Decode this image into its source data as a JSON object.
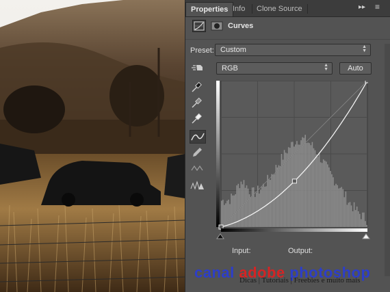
{
  "tabs": [
    {
      "label": "Properties",
      "active": true
    },
    {
      "label": "Info",
      "active": false
    },
    {
      "label": "Clone Source",
      "active": false
    }
  ],
  "tab_controls": {
    "expand": "▸▸",
    "menu": "≡"
  },
  "header": {
    "title": "Curves",
    "icons": [
      "curves-adjustment-icon",
      "layer-mask-icon"
    ]
  },
  "preset": {
    "label": "Preset:",
    "value": "Custom"
  },
  "channel": {
    "value": "RGB"
  },
  "auto_label": "Auto",
  "tools": [
    {
      "name": "target-adjust-hand-icon",
      "active": false
    },
    {
      "name": "black-point-eyedropper-icon",
      "active": false
    },
    {
      "name": "gray-point-eyedropper-icon",
      "active": false
    },
    {
      "name": "white-point-eyedropper-icon",
      "active": false
    },
    {
      "name": "curve-points-icon",
      "active": true
    },
    {
      "name": "pencil-draw-icon",
      "active": false
    },
    {
      "name": "smooth-curve-icon",
      "active": false
    },
    {
      "name": "clipping-warning-icon",
      "active": false
    }
  ],
  "curve": {
    "input_output_points": [
      [
        0,
        0
      ],
      [
        128,
        80
      ],
      [
        255,
        255
      ]
    ],
    "channel": "RGB"
  },
  "io": {
    "input_label": "Input:",
    "output_label": "Output:"
  },
  "watermark": {
    "brand": "canal adobe photoshop",
    "brand_parts": [
      "canal ",
      "adobe",
      " photoshop"
    ],
    "tagline": "Dicas | Tutoriais | Freebies e muito mais"
  },
  "colors": {
    "panel_bg": "#535353",
    "tab_bar": "#3c3c3c",
    "graph_bg": "#5a5a5a",
    "wm_blue": "#2d3ec9",
    "wm_red": "#d42424"
  }
}
